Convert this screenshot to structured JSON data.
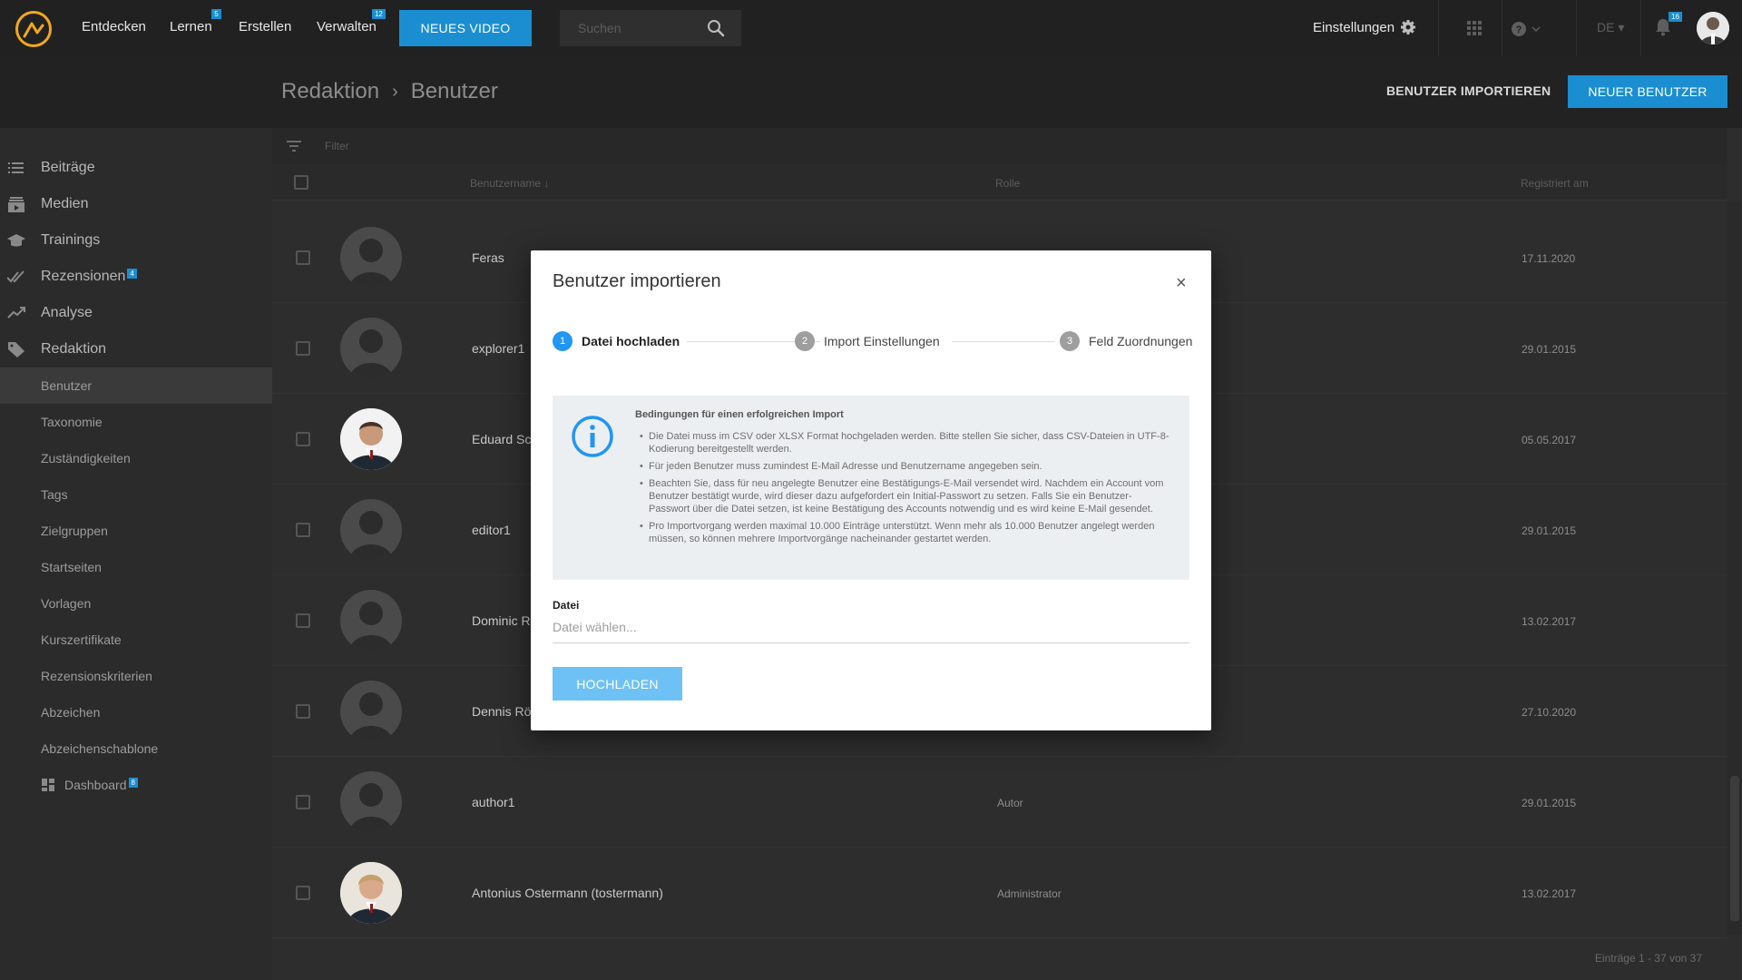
{
  "nav": {
    "items": [
      {
        "label": "Entdecken",
        "badge": ""
      },
      {
        "label": "Lernen",
        "badge": "5"
      },
      {
        "label": "Erstellen",
        "badge": ""
      },
      {
        "label": "Verwalten",
        "badge": "12"
      }
    ],
    "new_video": "NEUES VIDEO",
    "search_placeholder": "Suchen",
    "settings": "Einstellungen",
    "lang": "DE",
    "notifications_badge": "16"
  },
  "header": {
    "breadcrumb": [
      "Redaktion",
      "Benutzer"
    ],
    "import_button": "BENUTZER IMPORTIEREN",
    "new_user_button": "NEUER BENUTZER"
  },
  "sidebar": {
    "main": [
      {
        "label": "Beiträge",
        "icon": "list-icon",
        "badge": ""
      },
      {
        "label": "Medien",
        "icon": "media-icon",
        "badge": ""
      },
      {
        "label": "Trainings",
        "icon": "graduation-icon",
        "badge": ""
      },
      {
        "label": "Rezensionen",
        "icon": "double-check-icon",
        "badge": "4"
      },
      {
        "label": "Analyse",
        "icon": "trend-icon",
        "badge": ""
      },
      {
        "label": "Redaktion",
        "icon": "tag-icon",
        "badge": ""
      }
    ],
    "sub": [
      {
        "label": "Benutzer"
      },
      {
        "label": "Taxonomie"
      },
      {
        "label": "Zuständigkeiten"
      },
      {
        "label": "Tags"
      },
      {
        "label": "Zielgruppen"
      },
      {
        "label": "Startseiten"
      },
      {
        "label": "Vorlagen"
      },
      {
        "label": "Kurszertifikate"
      },
      {
        "label": "Rezensionskriterien"
      },
      {
        "label": "Abzeichen"
      },
      {
        "label": "Abzeichenschablone"
      }
    ],
    "dashboard": {
      "label": "Dashboard",
      "badge": "8"
    }
  },
  "table": {
    "filter_label": "Filter",
    "headers": {
      "username": "Benutzername",
      "role": "Rolle",
      "registered": "Registriert am"
    },
    "rows": [
      {
        "name": "Feras",
        "role": "",
        "date": "17.11.2020",
        "photo": false
      },
      {
        "name": "explorer1",
        "role": "",
        "date": "29.01.2015",
        "photo": false
      },
      {
        "name": "Eduard Sch",
        "role": "",
        "date": "05.05.2017",
        "photo": true
      },
      {
        "name": "editor1",
        "role": "",
        "date": "29.01.2015",
        "photo": false
      },
      {
        "name": "Dominic Ra",
        "role": "",
        "date": "13.02.2017",
        "photo": false
      },
      {
        "name": "Dennis Röt",
        "role": "",
        "date": "27.10.2020",
        "photo": false
      },
      {
        "name": "author1",
        "role": "Autor",
        "date": "29.01.2015",
        "photo": false
      },
      {
        "name": "Antonius Ostermann (tostermann)",
        "role": "Administrator",
        "date": "13.02.2017",
        "photo": true
      }
    ],
    "footer": "Einträge 1 - 37 von 37"
  },
  "modal": {
    "title": "Benutzer importieren",
    "close": "×",
    "steps": [
      {
        "num": "1",
        "label": "Datei hochladen"
      },
      {
        "num": "2",
        "label": "Import Einstellungen"
      },
      {
        "num": "3",
        "label": "Feld Zuordnungen"
      }
    ],
    "info_title": "Bedingungen für einen erfolgreichen Import",
    "info_items": [
      "Die Datei muss im CSV oder XLSX Format hochgeladen werden. Bitte stellen Sie sicher, dass CSV-Dateien in UTF-8-Kodierung bereitgestellt werden.",
      "Für jeden Benutzer muss zumindest E-Mail Adresse und Benutzername angegeben sein.",
      "Beachten Sie, dass für neu angelegte Benutzer eine Bestätigungs-E-Mail versendet wird. Nachdem ein Account vom Benutzer bestätigt wurde, wird dieser dazu aufgefordert ein Initial-Passwort zu setzen. Falls Sie ein Benutzer-Passwort über die Datei setzen, ist keine Bestätigung des Accounts notwendig und es wird keine E-Mail gesendet.",
      "Pro Importvorgang werden maximal 10.000 Einträge unterstützt. Wenn mehr als 10.000 Benutzer angelegt werden müssen, so können mehrere Importvorgänge nacheinander gestartet werden."
    ],
    "file_label": "Datei",
    "file_placeholder": "Datei wählen...",
    "upload_button": "HOCHLADEN"
  },
  "colors": {
    "accent": "#1a8ed1",
    "step_active": "#2196f3",
    "upload": "#6ec1f4"
  }
}
